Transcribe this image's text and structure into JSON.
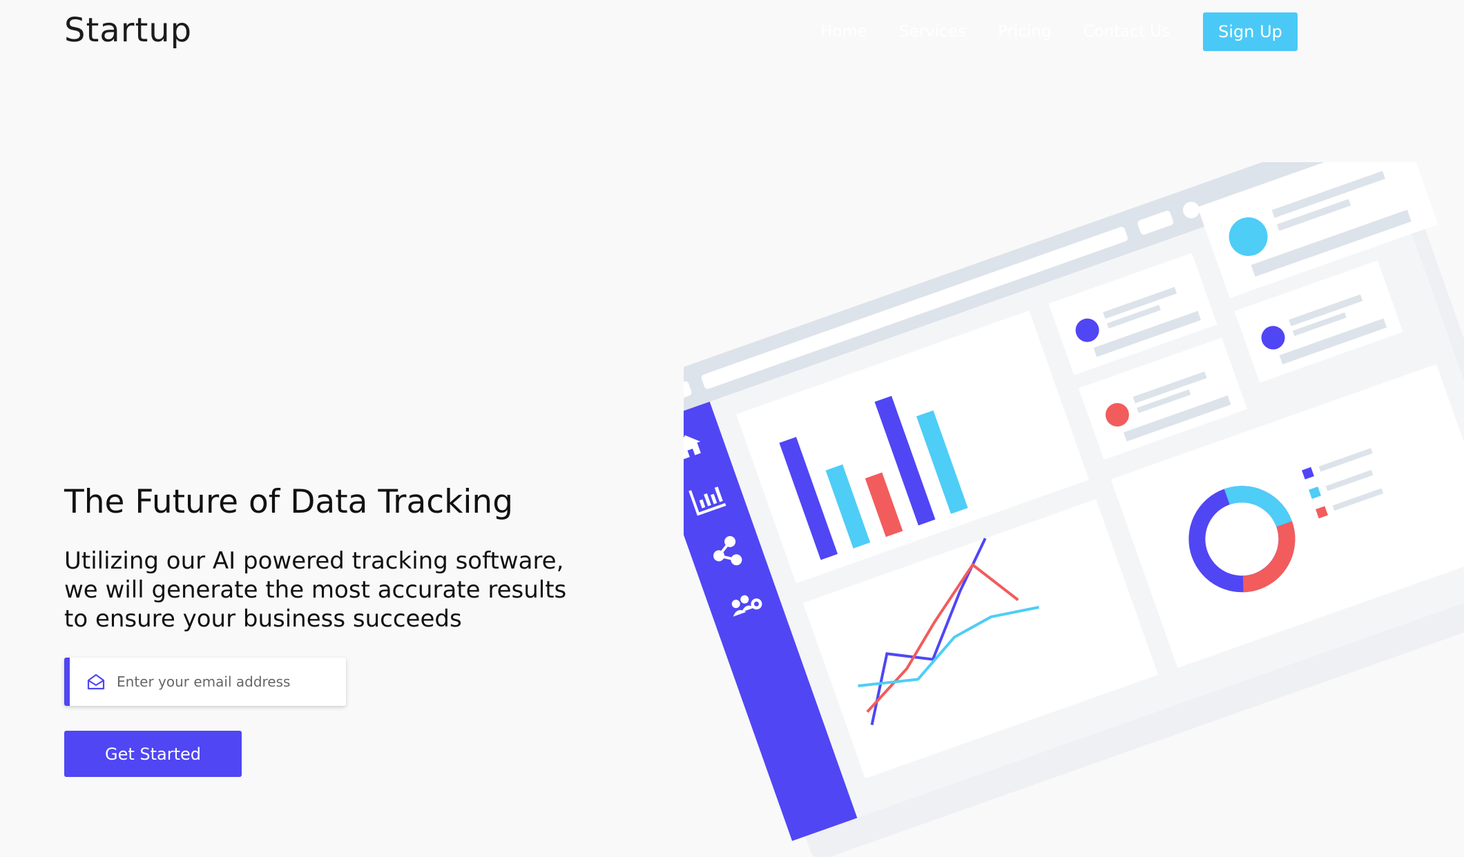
{
  "header": {
    "logo": "Startup",
    "nav": [
      "Home",
      "Services",
      "Pricing",
      "Contact Us"
    ],
    "signup_label": "Sign Up"
  },
  "hero": {
    "title": "The Future of Data Tracking",
    "subtitle_lines": [
      "Utilizing our AI powered tracking software,",
      "we will generate the most accurate results",
      "to ensure your business succeeds"
    ],
    "email_placeholder": "Enter your email address",
    "cta_label": "Get Started"
  },
  "colors": {
    "accent": "#5046f4",
    "signup": "#4ac9f7",
    "cyan": "#4ecdf7",
    "red": "#f25c5c",
    "frame": "#dde3ea"
  },
  "icons": {
    "email": "envelope-open-icon",
    "sidebar": [
      "home-icon",
      "bar-chart-icon",
      "share-icon",
      "users-gear-icon"
    ]
  }
}
